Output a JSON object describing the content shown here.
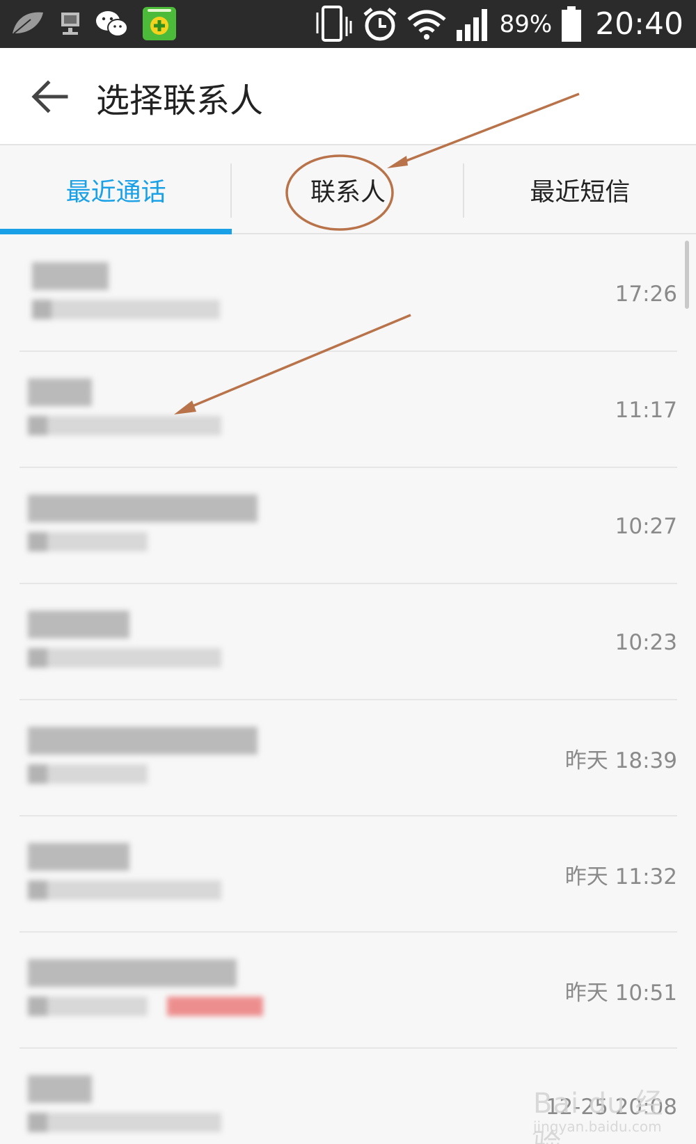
{
  "status_bar": {
    "battery_percent": "89%",
    "clock": "20:40",
    "icons": [
      "leaf-icon",
      "network-monitor-icon",
      "wechat-icon",
      "security-app-icon",
      "vibrate-icon",
      "alarm-icon",
      "wifi-icon",
      "signal-icon",
      "battery-icon"
    ]
  },
  "header": {
    "title": "选择联系人",
    "back_icon": "arrow-left-icon"
  },
  "tabs": [
    {
      "label": "最近通话",
      "active": true
    },
    {
      "label": "联系人",
      "active": false
    },
    {
      "label": "最近短信",
      "active": false
    }
  ],
  "calls": [
    {
      "time": "17:26"
    },
    {
      "time": "11:17"
    },
    {
      "time": "10:27"
    },
    {
      "time": "10:23"
    },
    {
      "time": "昨天 18:39"
    },
    {
      "time": "昨天 11:32"
    },
    {
      "time": "昨天 10:51"
    },
    {
      "time": "12-25 20:08"
    }
  ],
  "watermark": {
    "text": "Bai du 经验",
    "sub": "jingyan.baidu.com"
  },
  "colors": {
    "accent": "#1aa0e6",
    "annotation": "#b8734a"
  }
}
